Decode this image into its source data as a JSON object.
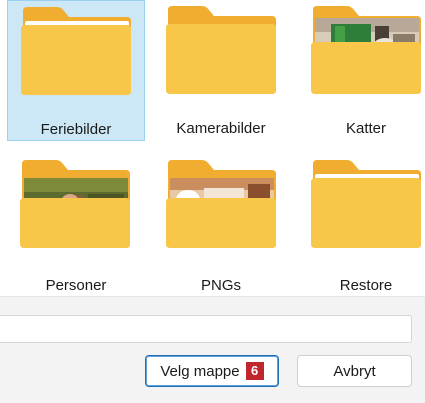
{
  "folders": [
    {
      "name": "Feriebilder",
      "selected": true,
      "thumbnail": "none"
    },
    {
      "name": "Kamerabilder",
      "selected": false,
      "thumbnail": "none"
    },
    {
      "name": "Katter",
      "selected": false,
      "thumbnail": "photo"
    },
    {
      "name": "Personer",
      "selected": false,
      "thumbnail": "photo"
    },
    {
      "name": "PNGs",
      "selected": false,
      "thumbnail": "photo"
    },
    {
      "name": "Restore",
      "selected": false,
      "thumbnail": "none"
    }
  ],
  "path_field": {
    "value": ""
  },
  "buttons": {
    "select_folder_label": "Velg mappe",
    "select_folder_badge": "6",
    "cancel_label": "Avbryt"
  },
  "colors": {
    "folder_front": "#f8c74a",
    "folder_back": "#f3b13a",
    "selection_bg": "#cce8f7",
    "badge": "#c0262d"
  },
  "icons": {
    "folder": "folder-icon"
  }
}
